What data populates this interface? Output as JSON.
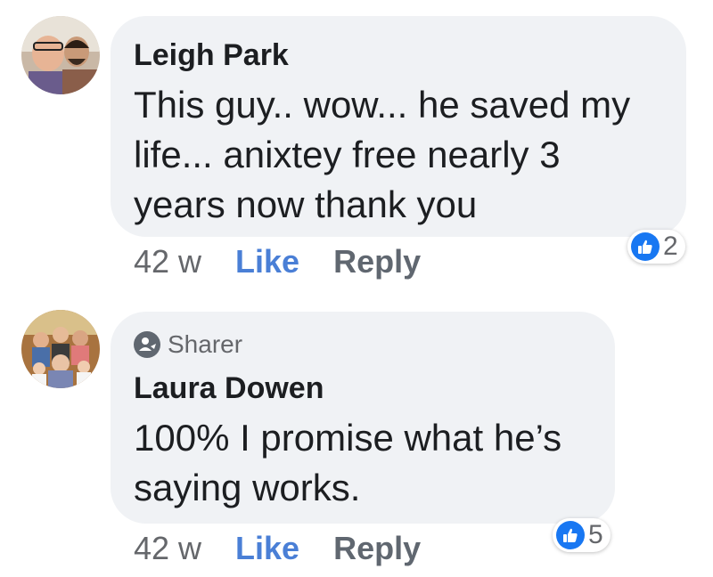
{
  "comments": [
    {
      "author": "Leigh Park",
      "text": "This guy.. wow... he saved my\nlife... anixtey free nearly 3\nyears now thank you",
      "time": "42 w",
      "like_label": "Like",
      "reply_label": "Reply",
      "reaction_count": "2",
      "reaction_icon": "thumbs-up-icon"
    },
    {
      "badge": "Sharer",
      "author": "Laura Dowen",
      "text": "100% I promise what he’s\nsaying works.",
      "time": "42 w",
      "like_label": "Like",
      "reply_label": "Reply",
      "reaction_count": "5",
      "reaction_icon": "thumbs-up-icon"
    }
  ],
  "colors": {
    "bubble": "#f0f2f5",
    "like_link": "#4a7fd6",
    "reaction_badge": "#1877f2",
    "text": "#1c1e21",
    "meta": "#65676b"
  }
}
